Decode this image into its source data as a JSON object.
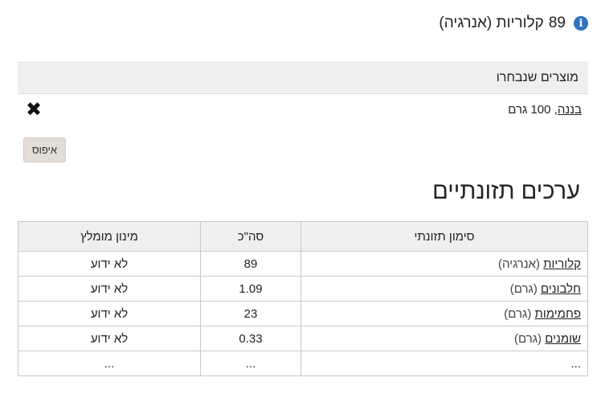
{
  "summary": {
    "value": "89",
    "label": "קלוריות (אנרגיה)",
    "info_icon": "i"
  },
  "selected": {
    "header": "מוצרים שנבחרו",
    "items": [
      {
        "name": "בננה",
        "amount": ", 100 גרם",
        "remove_icon": "✖"
      }
    ],
    "reset_label": "איפוס"
  },
  "nutrition": {
    "title": "ערכים תזונתיים",
    "headers": {
      "name": "סימון תזונתי",
      "total": "סה\"כ",
      "min": "מינון מומלץ"
    },
    "rows": [
      {
        "name": "קלוריות",
        "unit": "(אנרגיה)",
        "total": "89",
        "min": "לא ידוע"
      },
      {
        "name": "חלבונים",
        "unit": "(גרם)",
        "total": "1.09",
        "min": "לא ידוע"
      },
      {
        "name": "פחמימות",
        "unit": "(גרם)",
        "total": "23",
        "min": "לא ידוע"
      },
      {
        "name": "שומנים",
        "unit": "(גרם)",
        "total": "0.33",
        "min": "לא ידוע"
      },
      {
        "name": "...",
        "unit": "",
        "total": "...",
        "min": "..."
      }
    ]
  }
}
